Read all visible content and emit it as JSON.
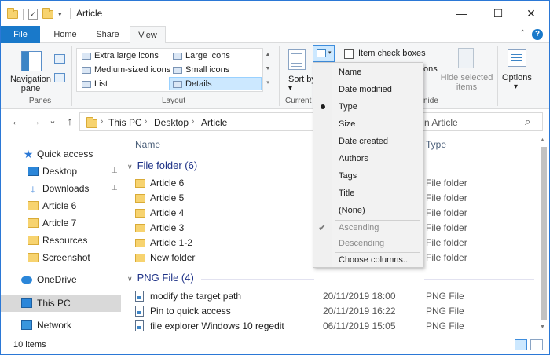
{
  "window": {
    "title": "Article",
    "minimize_glyph": "—",
    "maximize_glyph": "☐",
    "close_glyph": "✕"
  },
  "qat": {
    "check_glyph": "✓",
    "arrow_glyph": "▾"
  },
  "ribbon": {
    "tabs": [
      {
        "label": "File"
      },
      {
        "label": "Home"
      },
      {
        "label": "Share"
      },
      {
        "label": "View"
      }
    ],
    "active_tab": "View",
    "collapse_glyph": "⌃",
    "help_glyph": "?",
    "panes": {
      "label": "Panes",
      "navigation_pane_label": "Navigation pane"
    },
    "layout": {
      "label": "Layout",
      "items": [
        {
          "label": "Extra large icons"
        },
        {
          "label": "Large icons"
        },
        {
          "label": "Medium-sized icons"
        },
        {
          "label": "Small icons"
        },
        {
          "label": "List"
        },
        {
          "label": "Details"
        }
      ],
      "selected": "Details"
    },
    "current_view": {
      "label": "Current",
      "sort_by_label": "Sort by"
    },
    "show_hide": {
      "item_check_boxes_label": "Item check boxes",
      "options_partial": "ons",
      "label_partial": "nide",
      "hide_selected_items_label": "Hide selected items"
    },
    "options": {
      "label": "Options"
    }
  },
  "address": {
    "back_glyph": "←",
    "forward_glyph": "→",
    "recent_glyph": "⌄",
    "up_glyph": "↑",
    "parts": [
      "This PC",
      "Desktop",
      "Article"
    ],
    "chevron": "›",
    "dropdown_glyph": "⌄",
    "refresh_glyph": "↻",
    "search_placeholder": "n Article",
    "search_glyph": "⌕"
  },
  "nav": {
    "items": [
      {
        "label": "Quick access"
      },
      {
        "label": "Desktop",
        "pinned": true
      },
      {
        "label": "Downloads",
        "pinned": true
      },
      {
        "label": "Article 6"
      },
      {
        "label": "Article 7"
      },
      {
        "label": "Resources"
      },
      {
        "label": "Screenshot"
      },
      {
        "label": "OneDrive"
      },
      {
        "label": "This PC",
        "selected": true
      },
      {
        "label": "Network"
      }
    ],
    "pin_glyph": "📌",
    "star_glyph": "★",
    "download_glyph": "↓",
    "expand_glyph": "›"
  },
  "columns": {
    "name": "Name",
    "type": "Type"
  },
  "groups": [
    {
      "header": "File folder (6)",
      "files": [
        {
          "name": "Article 6",
          "date": "",
          "type": "File folder"
        },
        {
          "name": "Article 5",
          "date": "",
          "type": "File folder"
        },
        {
          "name": "Article 4",
          "date": "",
          "type": "File folder"
        },
        {
          "name": "Article 3",
          "date": "",
          "type": "File folder"
        },
        {
          "name": "Article 1-2",
          "date": "",
          "type": "File folder"
        },
        {
          "name": "New folder",
          "date": "",
          "type": "File folder"
        }
      ]
    },
    {
      "header": "PNG File (4)",
      "files": [
        {
          "name": "modify the target path",
          "date": "20/11/2019 18:00",
          "type": "PNG File"
        },
        {
          "name": "Pin to quick access",
          "date": "20/11/2019 16:22",
          "type": "PNG File"
        },
        {
          "name": "file explorer Windows 10 regedit",
          "date": "06/11/2019 15:05",
          "type": "PNG File"
        }
      ]
    }
  ],
  "group_chevron": "∨",
  "status": {
    "item_count": "10 items"
  },
  "sort_menu": {
    "items": [
      {
        "label": "Name"
      },
      {
        "label": "Date modified"
      },
      {
        "label": "Type",
        "selected": true
      },
      {
        "label": "Size"
      },
      {
        "label": "Date created"
      },
      {
        "label": "Authors"
      },
      {
        "label": "Tags"
      },
      {
        "label": "Title"
      },
      {
        "label": "(None)"
      }
    ],
    "order": [
      {
        "label": "Ascending",
        "checked": true
      },
      {
        "label": "Descending"
      }
    ],
    "choose_columns": "Choose columns...",
    "check_glyph": "✔"
  },
  "colors": {
    "accent": "#1979ca",
    "selection": "#cce8ff",
    "group_header": "#1e3287",
    "folder": "#f7d36f"
  }
}
